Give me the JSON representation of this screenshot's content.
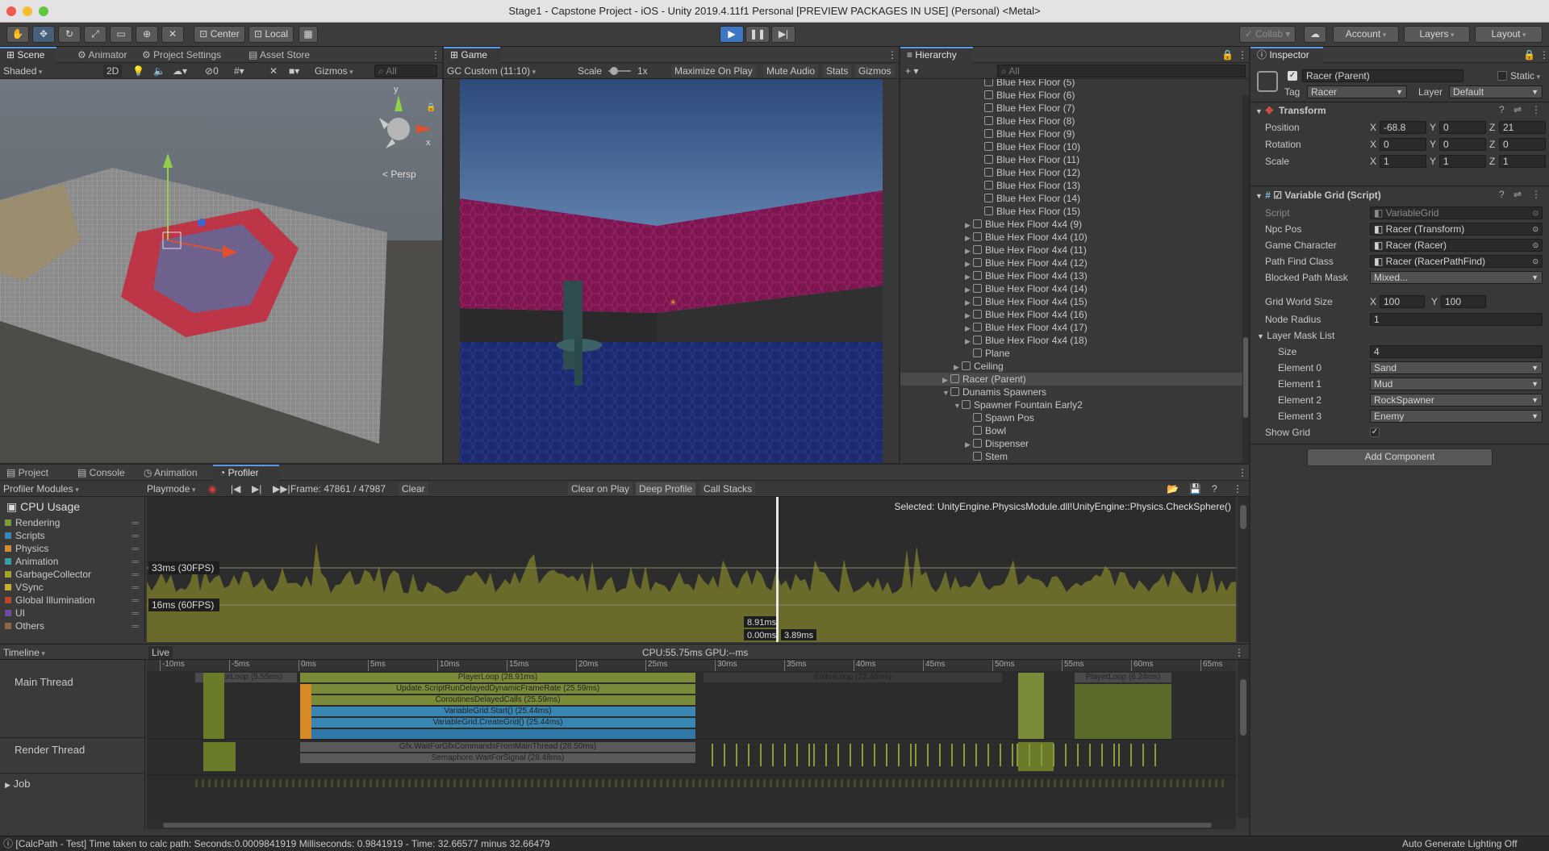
{
  "window": {
    "title": "Stage1 - Capstone Project - iOS - Unity 2019.4.11f1 Personal [PREVIEW PACKAGES IN USE] (Personal) <Metal>"
  },
  "toolbar": {
    "center_label": "Center",
    "local_label": "Local",
    "collab_label": "Collab",
    "account_label": "Account",
    "layers_label": "Layers",
    "layout_label": "Layout"
  },
  "scene": {
    "tabs": [
      "Scene",
      "Animator",
      "Project Settings",
      "Asset Store"
    ],
    "shading": "Shaded",
    "mode_2d": "2D",
    "fx_count": "0",
    "gizmos": "Gizmos",
    "search_placeholder": "All",
    "persp_label": "< Persp",
    "gizmo_axes": {
      "x": "x",
      "y": "y"
    }
  },
  "game": {
    "tab": "Game",
    "aspect": "GC Custom (11:10)",
    "scale_label": "Scale",
    "scale_value": "1x",
    "maximize": "Maximize On Play",
    "mute": "Mute Audio",
    "stats": "Stats",
    "gizmos": "Gizmos"
  },
  "hierarchy": {
    "tab": "Hierarchy",
    "search_placeholder": "All",
    "items": [
      {
        "label": "Blue Hex Floor (5)",
        "indent": 3,
        "arrow": ""
      },
      {
        "label": "Blue Hex Floor (6)",
        "indent": 3,
        "arrow": ""
      },
      {
        "label": "Blue Hex Floor (7)",
        "indent": 3,
        "arrow": ""
      },
      {
        "label": "Blue Hex Floor (8)",
        "indent": 3,
        "arrow": ""
      },
      {
        "label": "Blue Hex Floor (9)",
        "indent": 3,
        "arrow": ""
      },
      {
        "label": "Blue Hex Floor (10)",
        "indent": 3,
        "arrow": ""
      },
      {
        "label": "Blue Hex Floor (11)",
        "indent": 3,
        "arrow": ""
      },
      {
        "label": "Blue Hex Floor (12)",
        "indent": 3,
        "arrow": ""
      },
      {
        "label": "Blue Hex Floor (13)",
        "indent": 3,
        "arrow": ""
      },
      {
        "label": "Blue Hex Floor (14)",
        "indent": 3,
        "arrow": ""
      },
      {
        "label": "Blue Hex Floor (15)",
        "indent": 3,
        "arrow": ""
      },
      {
        "label": "Blue Hex Floor 4x4 (9)",
        "indent": 2,
        "arrow": "▶"
      },
      {
        "label": "Blue Hex Floor 4x4 (10)",
        "indent": 2,
        "arrow": "▶"
      },
      {
        "label": "Blue Hex Floor 4x4 (11)",
        "indent": 2,
        "arrow": "▶"
      },
      {
        "label": "Blue Hex Floor 4x4 (12)",
        "indent": 2,
        "arrow": "▶"
      },
      {
        "label": "Blue Hex Floor 4x4 (13)",
        "indent": 2,
        "arrow": "▶"
      },
      {
        "label": "Blue Hex Floor 4x4 (14)",
        "indent": 2,
        "arrow": "▶"
      },
      {
        "label": "Blue Hex Floor 4x4 (15)",
        "indent": 2,
        "arrow": "▶"
      },
      {
        "label": "Blue Hex Floor 4x4 (16)",
        "indent": 2,
        "arrow": "▶"
      },
      {
        "label": "Blue Hex Floor 4x4 (17)",
        "indent": 2,
        "arrow": "▶"
      },
      {
        "label": "Blue Hex Floor 4x4 (18)",
        "indent": 2,
        "arrow": "▶"
      },
      {
        "label": "Plane",
        "indent": 2,
        "arrow": ""
      },
      {
        "label": "Ceiling",
        "indent": 1,
        "arrow": "▶"
      },
      {
        "label": "Racer (Parent)",
        "indent": 0,
        "arrow": "▶",
        "selected": true
      },
      {
        "label": "Dunamis Spawners",
        "indent": 0,
        "arrow": "▼"
      },
      {
        "label": "Spawner Fountain Early2",
        "indent": 1,
        "arrow": "▼"
      },
      {
        "label": "Spawn Pos",
        "indent": 2,
        "arrow": ""
      },
      {
        "label": "Bowl",
        "indent": 2,
        "arrow": ""
      },
      {
        "label": "Dispenser",
        "indent": 2,
        "arrow": "▶"
      },
      {
        "label": "Stem",
        "indent": 2,
        "arrow": ""
      }
    ]
  },
  "inspector": {
    "tab": "Inspector",
    "object_name": "Racer (Parent)",
    "static_label": "Static",
    "tag_label": "Tag",
    "tag_value": "Racer",
    "layer_label": "Layer",
    "layer_value": "Default",
    "transform": {
      "title": "Transform",
      "position": {
        "label": "Position",
        "x": "-68.8",
        "y": "0",
        "z": "21"
      },
      "rotation": {
        "label": "Rotation",
        "x": "0",
        "y": "0",
        "z": "0"
      },
      "scale": {
        "label": "Scale",
        "x": "1",
        "y": "1",
        "z": "1"
      }
    },
    "script": {
      "title": "Variable Grid (Script)",
      "fields": [
        {
          "label": "Script",
          "value": "VariableGrid"
        },
        {
          "label": "Npc Pos",
          "value": "Racer (Transform)"
        },
        {
          "label": "Game Character",
          "value": "Racer (Racer)"
        },
        {
          "label": "Path Find Class",
          "value": "Racer (RacerPathFind)"
        },
        {
          "label": "Blocked Path Mask",
          "value": "Mixed..."
        }
      ],
      "grid_world_size_label": "Grid World Size",
      "grid_x": "100",
      "grid_y": "100",
      "node_radius_label": "Node Radius",
      "node_radius": "1",
      "layer_mask_list": "Layer Mask List",
      "size_label": "Size",
      "size_value": "4",
      "elements": [
        {
          "label": "Element 0",
          "value": "Sand"
        },
        {
          "label": "Element 1",
          "value": "Mud"
        },
        {
          "label": "Element 2",
          "value": "RockSpawner"
        },
        {
          "label": "Element 3",
          "value": "Enemy"
        }
      ],
      "show_grid_label": "Show Grid"
    },
    "add_component": "Add Component"
  },
  "bottom": {
    "tabs": [
      "Project",
      "Console",
      "Animation",
      "Profiler"
    ]
  },
  "profiler": {
    "modules_label": "Profiler Modules",
    "playmode": "Playmode",
    "frame": "Frame: 47861 / 47987",
    "clear": "Clear",
    "clear_on_play": "Clear on Play",
    "deep_profile": "Deep Profile",
    "call_stacks": "Call Stacks",
    "cpu_usage": "CPU Usage",
    "legend": [
      {
        "name": "Rendering",
        "color": "#7a9d3b"
      },
      {
        "name": "Scripts",
        "color": "#3a86b3"
      },
      {
        "name": "Physics",
        "color": "#cc8f34"
      },
      {
        "name": "Animation",
        "color": "#3a9fa0"
      },
      {
        "name": "GarbageCollector",
        "color": "#a3a12e"
      },
      {
        "name": "VSync",
        "color": "#c0b22e"
      },
      {
        "name": "Global Illumination",
        "color": "#b8462d"
      },
      {
        "name": "UI",
        "color": "#6f4aa0"
      },
      {
        "name": "Others",
        "color": "#8a6b48"
      }
    ],
    "selected_text": "Selected: UnityEngine.PhysicsModule.dll!UnityEngine::Physics.CheckSphere()",
    "label_33": "33ms (30FPS)",
    "label_16": "16ms (60FPS)",
    "cursor_val1": "8.91ms",
    "cursor_val2": "0.00ms",
    "cursor_val3": "3.89ms",
    "timeline_label": "Timeline",
    "live_label": "Live",
    "cpu_gpu": "CPU:55.75ms  GPU:--ms",
    "ticks": [
      "-10ms",
      "-5ms",
      "0ms",
      "5ms",
      "10ms",
      "15ms",
      "20ms",
      "25ms",
      "30ms",
      "35ms",
      "40ms",
      "45ms",
      "50ms",
      "55ms",
      "60ms",
      "65ms"
    ],
    "main_thread": "Main Thread",
    "render_thread": "Render Thread",
    "job": "Job",
    "bars": {
      "editorloop_left": "EditorLoop (5.55ms)",
      "playerloop": "PlayerLoop (28.91ms)",
      "update_script": "Update.ScriptRunDelayedDynamicFrameRate (25.59ms)",
      "coroutines": "CoroutinesDelayedCalls (25.59ms)",
      "vg_start": "VariableGrid.Start() (25.44ms)",
      "vg_create": "VariableGrid.CreateGrid() (25.44ms)",
      "editorloop_mid": "EditorLoop (22.46ms)",
      "playerloop_right": "PlayerLoop (6.24ms)",
      "gfx_wait": "Gfx.WaitForGfxCommandsFromMainThread (28.50ms)",
      "semaphore": "Semaphore.WaitForSignal (28.48ms)"
    },
    "chart_data": {
      "type": "area",
      "title": "CPU Usage",
      "ylabel": "ms",
      "reference_lines": [
        {
          "label": "33ms (30FPS)",
          "value": 33
        },
        {
          "label": "16ms (60FPS)",
          "value": 16
        }
      ],
      "cursor_values": [
        "8.91ms",
        "0.00ms",
        "3.89ms"
      ]
    }
  },
  "status": {
    "message": "[CalcPath - Test] Time taken to calc path: Seconds:0.0009841919 Milliseconds: 0.9841919 - Time: 32.66577 minus 32.66479",
    "lighting": "Auto Generate Lighting Off"
  }
}
